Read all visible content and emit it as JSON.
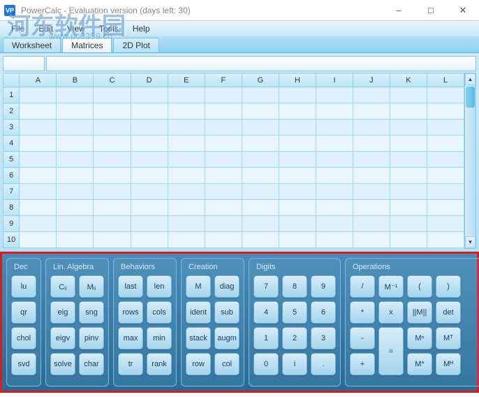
{
  "window": {
    "app_icon_text": "VP",
    "title": "PowerCalc - Evaluation version (days left: 30)"
  },
  "menu": {
    "items": [
      "File",
      "Edit",
      "View",
      "Tools",
      "Help"
    ]
  },
  "tabs": {
    "items": [
      "Worksheet",
      "Matrices",
      "2D Plot"
    ],
    "active": 1
  },
  "sheet": {
    "columns": [
      "A",
      "B",
      "C",
      "D",
      "E",
      "F",
      "G",
      "H",
      "I",
      "J",
      "K",
      "L"
    ],
    "rows": [
      "1",
      "2",
      "3",
      "4",
      "5",
      "6",
      "7",
      "8",
      "9",
      "10"
    ]
  },
  "panels": {
    "dec": {
      "title": "Dec",
      "buttons": [
        "lu",
        "qr",
        "chol",
        "svd"
      ]
    },
    "lin": {
      "title": "Lin. Algebra",
      "buttons": [
        "Cᵢⱼ",
        "Mᵢⱼ",
        "eig",
        "sng",
        "eigv",
        "pinv",
        "solve",
        "char"
      ]
    },
    "beh": {
      "title": "Behaviors",
      "buttons": [
        "last",
        "len",
        "rows",
        "cols",
        "max",
        "min",
        "tr",
        "rank"
      ]
    },
    "cre": {
      "title": "Creation",
      "buttons": [
        "M",
        "diag",
        "ident",
        "sub",
        "stack",
        "augm",
        "row",
        "col"
      ]
    },
    "dig": {
      "title": "Digits",
      "buttons": [
        "7",
        "8",
        "9",
        "4",
        "5",
        "6",
        "1",
        "2",
        "3",
        "0",
        "i",
        "."
      ]
    },
    "ops": {
      "title": "Operations",
      "buttons_left": [
        "/",
        "*",
        "-",
        "+"
      ],
      "equals": "=",
      "buttons_right": [
        "M⁻¹",
        "(",
        ")",
        "x",
        "||M||",
        "det",
        "Mⁿ",
        "Mᵀ",
        "M*",
        "Mᴴ"
      ]
    }
  },
  "watermark": {
    "line1": "河东软件园",
    "line2": "www.pc0359.cn"
  }
}
